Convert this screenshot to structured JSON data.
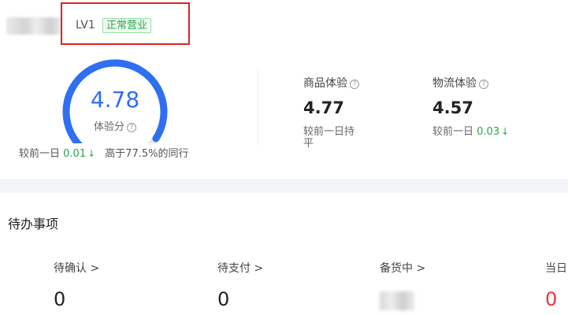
{
  "shop": {
    "level": "LV1",
    "status": "正常营业"
  },
  "experience": {
    "score": "4.78",
    "score_fraction": 0.956,
    "label": "体验分",
    "help": "?",
    "compare_prefix": "较前一日",
    "compare_value": "0.01",
    "compare_arrow": "↓",
    "peer_text": "高于77.5%的同行"
  },
  "metrics": [
    {
      "label": "商品体验",
      "value": "4.77",
      "compare_line1": "较前一日持",
      "compare_line2": "平"
    },
    {
      "label": "物流体验",
      "value": "4.57",
      "compare_prefix": "较前一日",
      "compare_value": "0.03",
      "compare_arrow": "↓"
    }
  ],
  "todo": {
    "title": "待办事项",
    "items": [
      {
        "label": "待确认 >",
        "value": "0"
      },
      {
        "label": "待支付 >",
        "value": "0"
      },
      {
        "label": "备货中 >",
        "value": ""
      },
      {
        "label": "当日",
        "value": "0"
      }
    ]
  },
  "colors": {
    "accent_blue": "#2f6ff0",
    "success_green": "#2ea44f",
    "alert_red": "#ee3333",
    "highlight_border": "#e02020"
  }
}
